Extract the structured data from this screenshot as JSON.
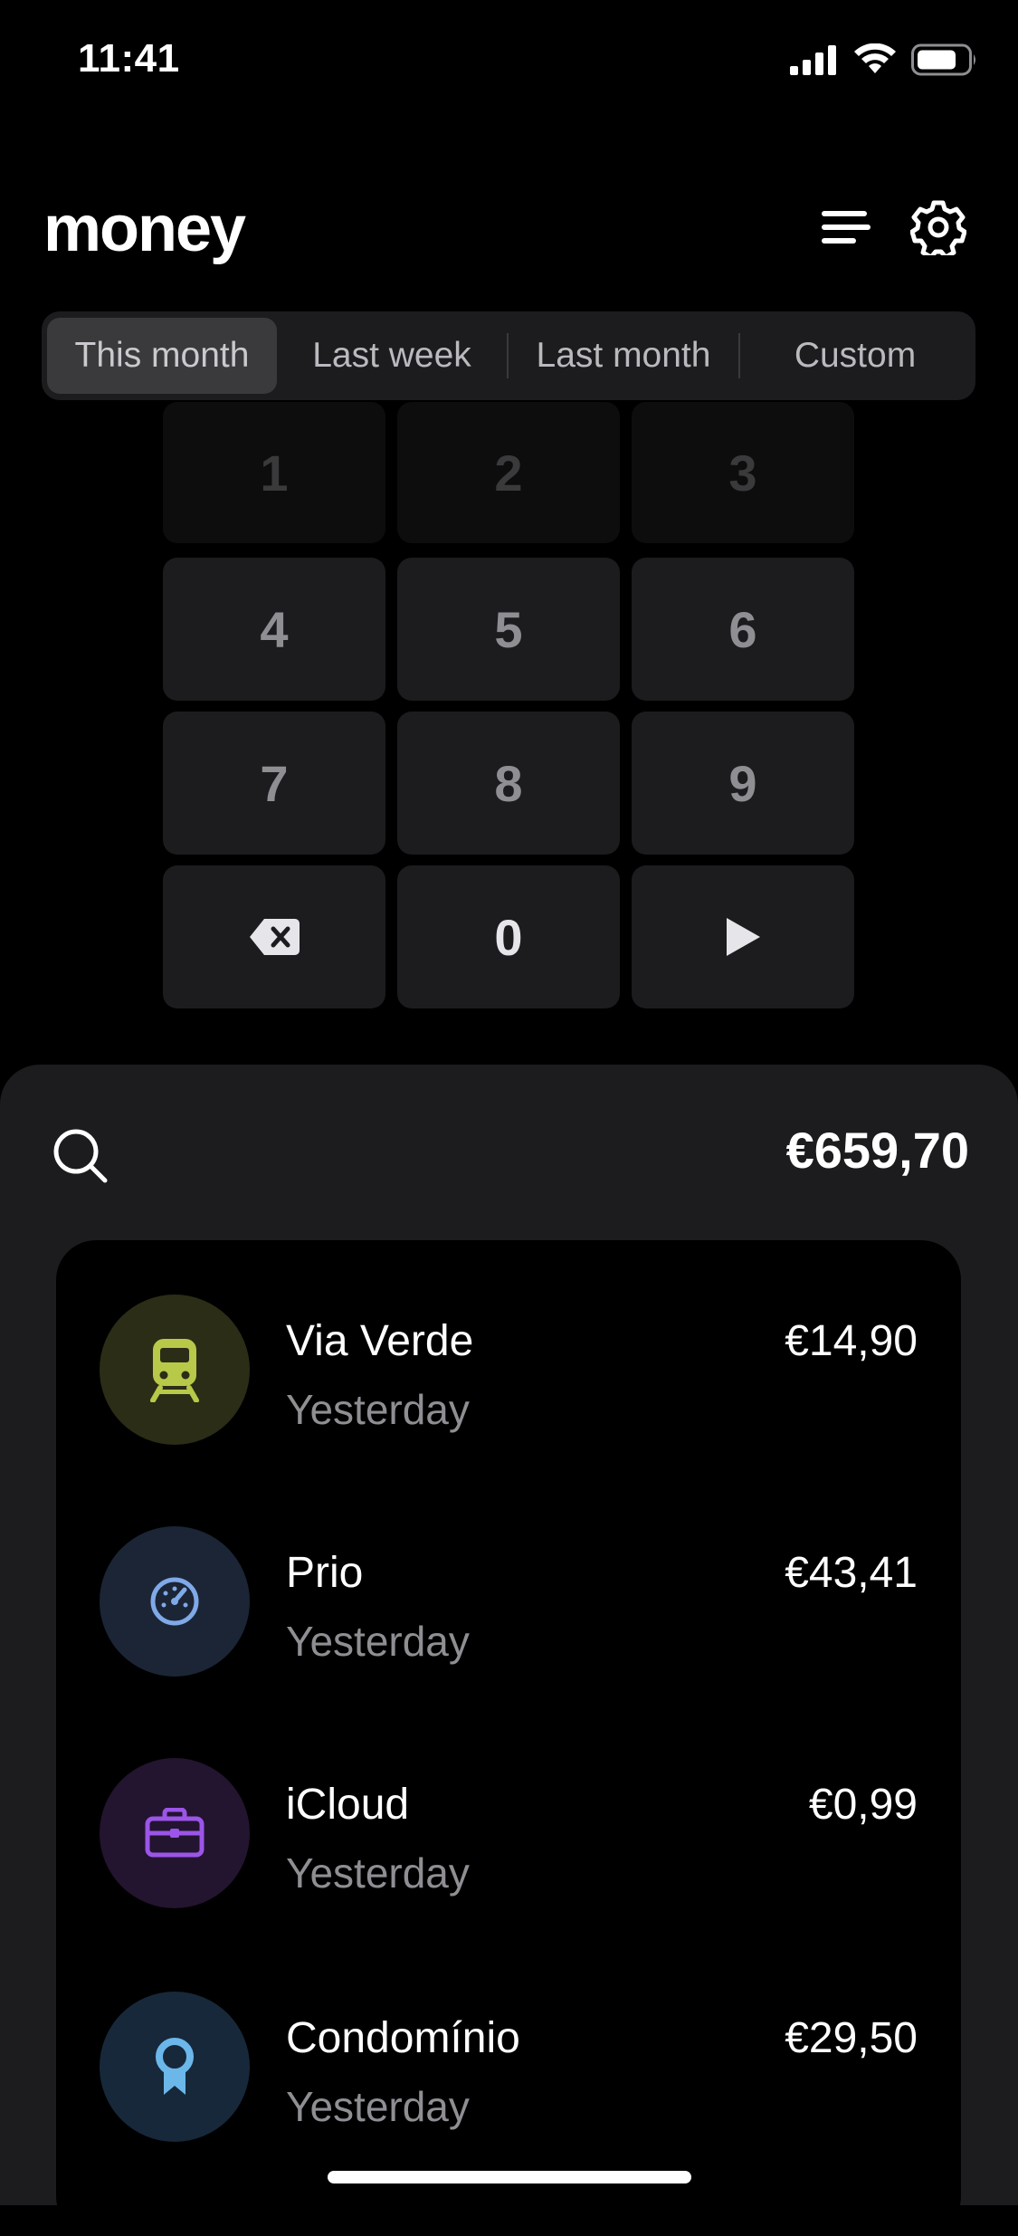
{
  "status_bar": {
    "time": "11:41"
  },
  "header": {
    "title": "money"
  },
  "period_tabs": [
    {
      "label": "This month",
      "active": true
    },
    {
      "label": "Last week",
      "active": false
    },
    {
      "label": "Last month",
      "active": false
    },
    {
      "label": "Custom",
      "active": false
    }
  ],
  "keypad": {
    "keys": [
      "1",
      "2",
      "3",
      "4",
      "5",
      "6",
      "7",
      "8",
      "9",
      "0"
    ],
    "delete_icon": "backspace-icon",
    "submit_icon": "play-icon"
  },
  "summary": {
    "total": "€659,70"
  },
  "transactions": [
    {
      "name": "Via Verde",
      "date": "Yesterday",
      "amount": "€14,90",
      "icon": "train-icon",
      "icon_color": "#b8c94a",
      "icon_bg": "#2b2d17"
    },
    {
      "name": "Prio",
      "date": "Yesterday",
      "amount": "€43,41",
      "icon": "speedometer-icon",
      "icon_color": "#7fa9e8",
      "icon_bg": "#1b2535"
    },
    {
      "name": "iCloud",
      "date": "Yesterday",
      "amount": "€0,99",
      "icon": "briefcase-icon",
      "icon_color": "#9b55e8",
      "icon_bg": "#23142f"
    },
    {
      "name": "Condomínio",
      "date": "Yesterday",
      "amount": "€29,50",
      "icon": "ribbon-icon",
      "icon_color": "#6bb7ea",
      "icon_bg": "#17283a"
    }
  ]
}
